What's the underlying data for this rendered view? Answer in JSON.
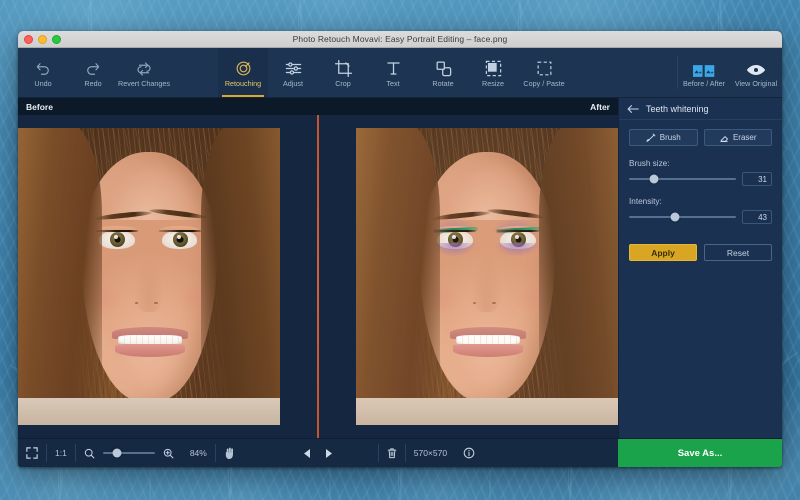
{
  "window": {
    "title": "Photo Retouch Movavi: Easy Portrait Editing – face.png",
    "controls": {
      "close": "close",
      "minimize": "minimize",
      "zoom": "zoom"
    }
  },
  "toolbar": {
    "left": [
      {
        "label": "Undo",
        "icon": "undo-icon"
      },
      {
        "label": "Redo",
        "icon": "redo-icon"
      },
      {
        "label": "Revert Changes",
        "icon": "revert-icon"
      }
    ],
    "center": [
      {
        "label": "Retouching",
        "icon": "retouching-icon",
        "active": true
      },
      {
        "label": "Adjust",
        "icon": "adjust-icon",
        "active": false
      },
      {
        "label": "Crop",
        "icon": "crop-icon",
        "active": false
      },
      {
        "label": "Text",
        "icon": "text-icon",
        "active": false
      },
      {
        "label": "Rotate",
        "icon": "rotate-icon",
        "active": false
      },
      {
        "label": "Resize",
        "icon": "resize-icon",
        "active": false
      },
      {
        "label": "Copy / Paste",
        "icon": "copy-paste-icon",
        "active": false
      }
    ],
    "right": [
      {
        "label": "Before / After",
        "icon": "before-after-icon",
        "active": true
      },
      {
        "label": "View Original",
        "icon": "eye-icon",
        "active": false
      }
    ]
  },
  "canvas": {
    "before_label": "Before",
    "after_label": "After",
    "divider_color": "#c4542a"
  },
  "panel": {
    "back_icon": "arrow-left-icon",
    "title": "Teeth whitening",
    "modes": [
      {
        "label": "Brush",
        "icon": "brush-icon",
        "selected": true
      },
      {
        "label": "Eraser",
        "icon": "eraser-icon",
        "selected": false
      }
    ],
    "sliders": [
      {
        "label": "Brush size:",
        "value": "31",
        "percent": 23
      },
      {
        "label": "Intensity:",
        "value": "43",
        "percent": 43
      }
    ],
    "apply_label": "Apply",
    "reset_label": "Reset",
    "apply_color": "#d8a623"
  },
  "bottombar": {
    "fit_icon": "fit-screen-icon",
    "actual_size_label": "1:1",
    "zoom_out_icon": "zoom-out-icon",
    "zoom_in_icon": "zoom-in-icon",
    "zoom_level": "84%",
    "zoom_percent": 28,
    "hand_icon": "hand-icon",
    "prev_icon": "prev-arrow-icon",
    "next_icon": "next-arrow-icon",
    "delete_icon": "trash-icon",
    "dimensions": "570×570",
    "info_icon": "info-icon",
    "save_label": "Save As...",
    "save_color": "#1aa34a"
  }
}
